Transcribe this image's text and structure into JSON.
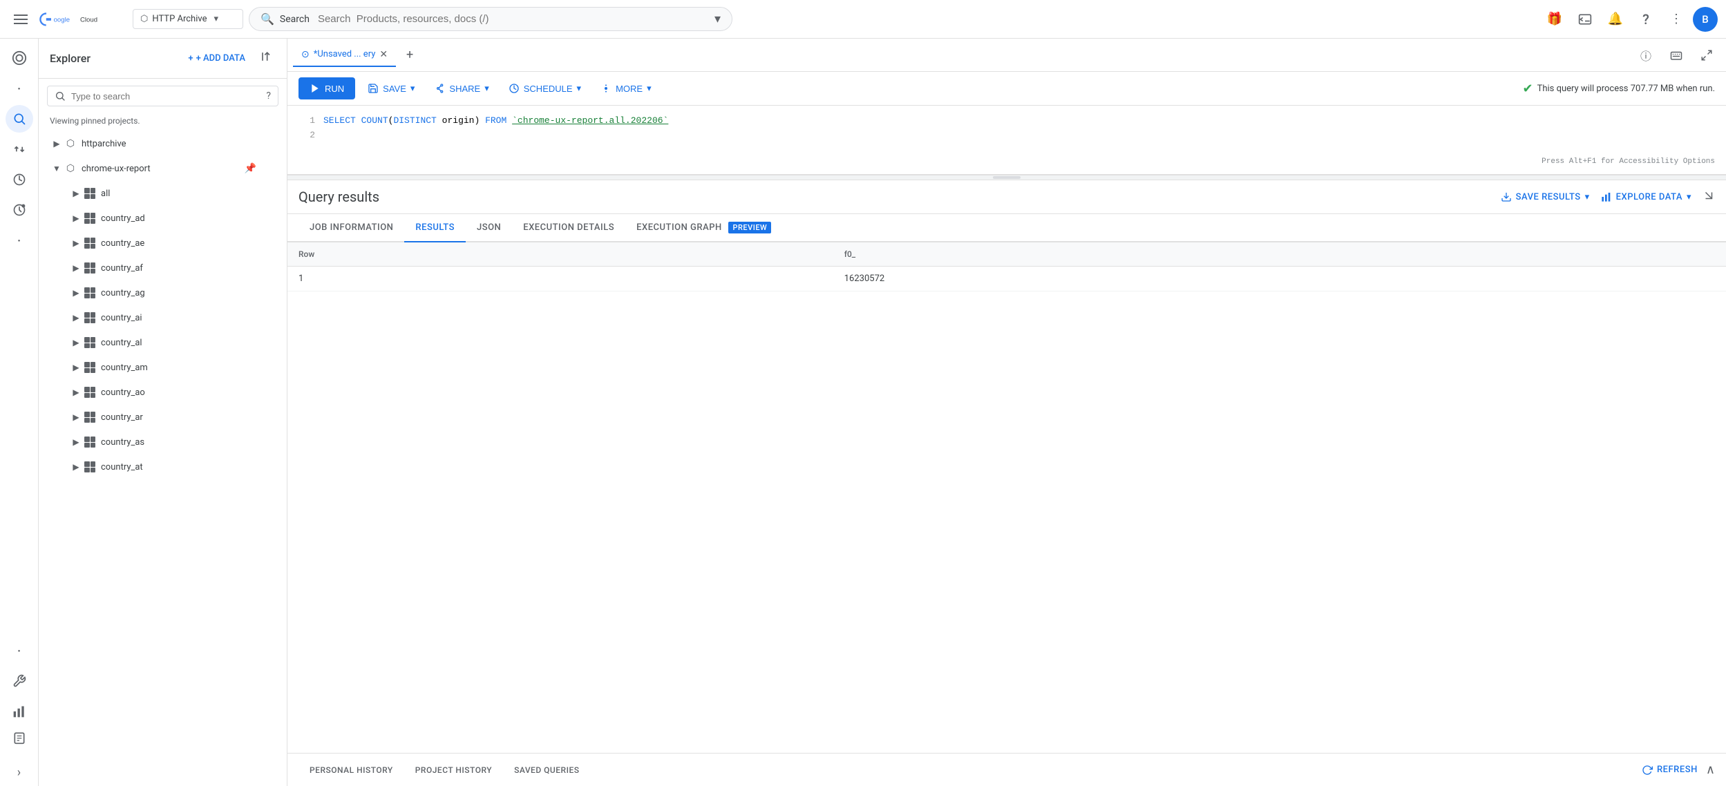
{
  "topNav": {
    "hamburger_label": "Menu",
    "logo_text": "Google Cloud",
    "project_icon": "⬡",
    "project_name": "HTTP Archive",
    "project_dropdown": "▾",
    "search_placeholder": "Search  Products, resources, docs (/)",
    "search_expand": "▾",
    "gift_icon": "🎁",
    "console_icon": "⬛",
    "bell_icon": "🔔",
    "help_icon": "?",
    "more_icon": "⋮",
    "avatar_label": "B"
  },
  "iconSidebar": {
    "dashboard_icon": "⊞",
    "search_icon": "🔍",
    "transfer_icon": "⇄",
    "history_icon": "🕐",
    "scheduled_icon": "🔄",
    "dot1": "•",
    "dot2": "•",
    "wrench_icon": "🔧",
    "chart_icon": "📊",
    "clipboard_icon": "📋",
    "expand_icon": "›"
  },
  "explorer": {
    "title": "Explorer",
    "add_data_label": "+ ADD DATA",
    "collapse_icon": "⟨|",
    "search_placeholder": "Type to search",
    "help_icon": "?",
    "viewing_text": "Viewing pinned projects.",
    "projects": [
      {
        "name": "httparchive",
        "expanded": false,
        "children": []
      },
      {
        "name": "chrome-ux-report",
        "expanded": true,
        "pinned": true,
        "children": [
          {
            "name": "all",
            "type": "table"
          },
          {
            "name": "country_ad",
            "type": "table"
          },
          {
            "name": "country_ae",
            "type": "table"
          },
          {
            "name": "country_af",
            "type": "table"
          },
          {
            "name": "country_ag",
            "type": "table"
          },
          {
            "name": "country_ai",
            "type": "table"
          },
          {
            "name": "country_al",
            "type": "table"
          },
          {
            "name": "country_am",
            "type": "table"
          },
          {
            "name": "country_ao",
            "type": "table"
          },
          {
            "name": "country_ar",
            "type": "table"
          },
          {
            "name": "country_as",
            "type": "table"
          },
          {
            "name": "country_at",
            "type": "table"
          }
        ]
      }
    ]
  },
  "queryEditor": {
    "tab_label": "*Unsaved ... ery",
    "tab_icon": "⊙",
    "new_tab_icon": "+",
    "toolbar": {
      "run_label": "RUN",
      "run_icon": "▶",
      "save_label": "SAVE",
      "save_icon": "💾",
      "share_label": "SHARE",
      "share_icon": "👥",
      "schedule_label": "SCHEDULE",
      "schedule_icon": "🕐",
      "more_label": "MORE",
      "more_icon": "⚙",
      "info_text": "This query will process 707.77 MB when run.",
      "check_icon": "✔"
    },
    "code": {
      "line1": "SELECT COUNT(DISTINCT origin) FROM `chrome-ux-report.all.202206`",
      "line2": ""
    },
    "accessibility_hint": "Press Alt+F1 for Accessibility Options",
    "resize_handle": "—"
  },
  "results": {
    "title": "Query results",
    "save_results_label": "SAVE RESULTS",
    "save_results_icon": "⬇",
    "explore_data_label": "EXPLORE DATA",
    "explore_data_icon": "📊",
    "expand_icon": "⇅",
    "tabs": [
      {
        "label": "JOB INFORMATION",
        "active": false
      },
      {
        "label": "RESULTS",
        "active": true
      },
      {
        "label": "JSON",
        "active": false
      },
      {
        "label": "EXECUTION DETAILS",
        "active": false
      },
      {
        "label": "EXECUTION GRAPH",
        "active": false,
        "badge": "PREVIEW"
      }
    ],
    "table": {
      "headers": [
        "Row",
        "f0_"
      ],
      "rows": [
        [
          "1",
          "16230572"
        ]
      ]
    }
  },
  "bottomBar": {
    "tabs": [
      {
        "label": "PERSONAL HISTORY"
      },
      {
        "label": "PROJECT HISTORY"
      },
      {
        "label": "SAVED QUERIES"
      }
    ],
    "refresh_label": "REFRESH",
    "refresh_icon": "🔄",
    "collapse_icon": "∧"
  }
}
